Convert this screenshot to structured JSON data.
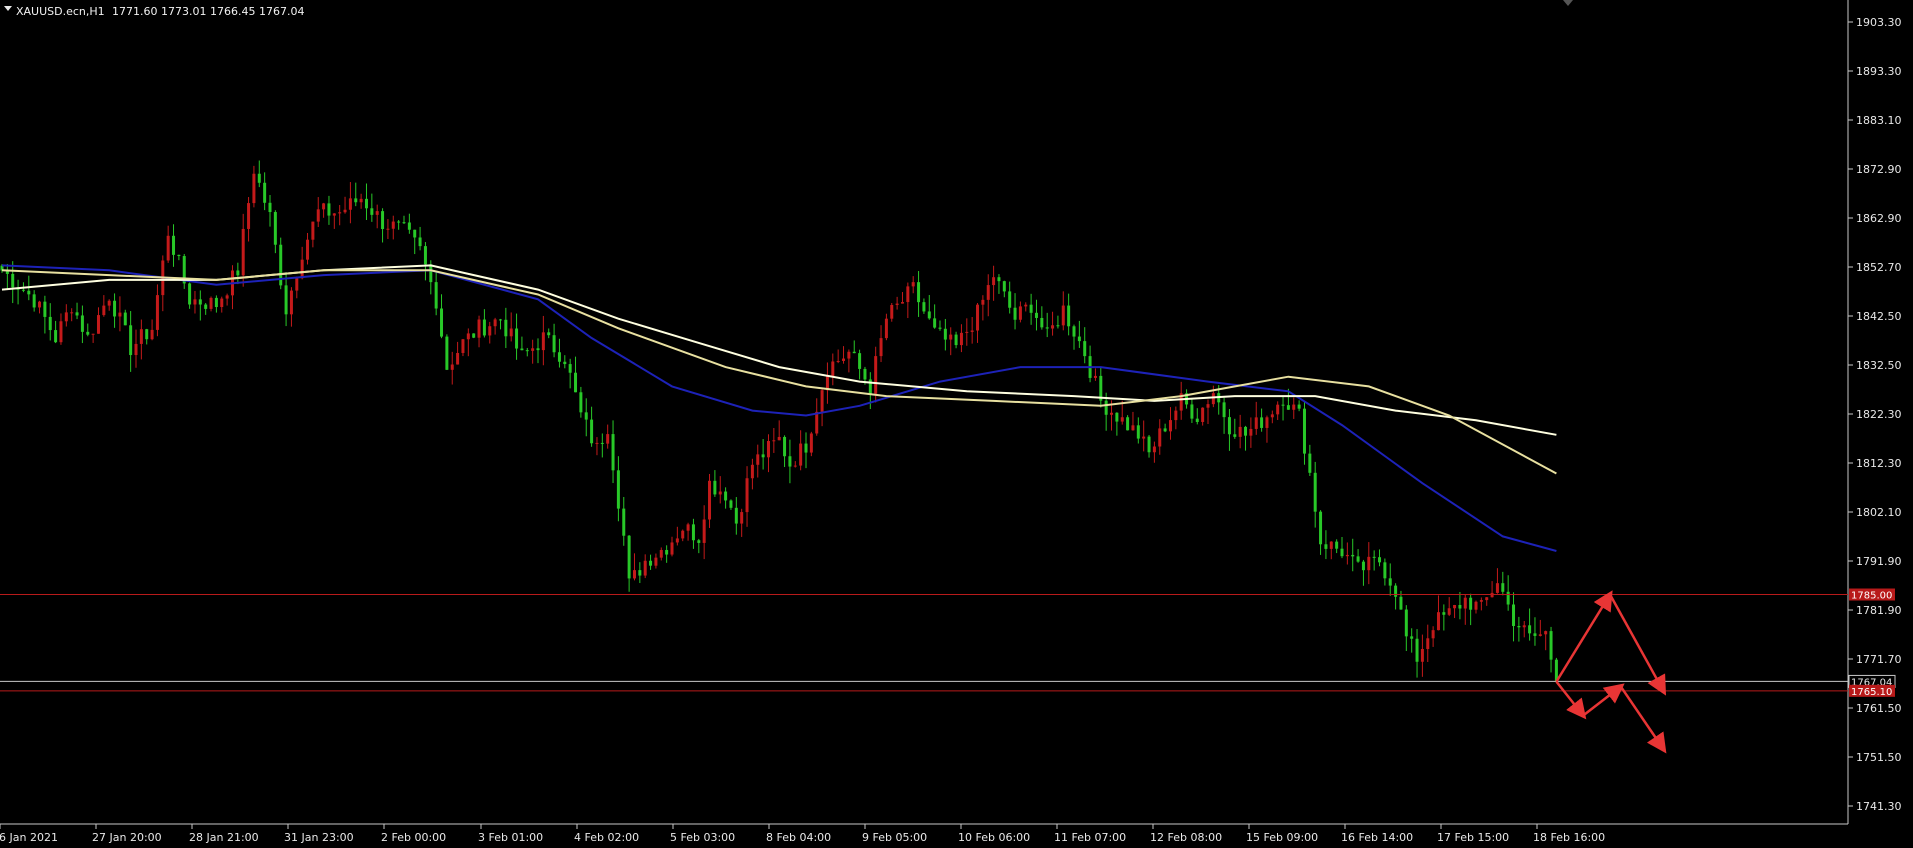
{
  "header": {
    "symbol": "XAUUSD.ecn,H1",
    "ohlc": "1771.60 1773.01 1766.45 1767.04"
  },
  "price_axis": {
    "labels": [
      "1903.30",
      "1893.30",
      "1883.10",
      "1872.90",
      "1862.90",
      "1852.70",
      "1842.50",
      "1832.50",
      "1822.30",
      "1812.30",
      "1802.10",
      "1791.90",
      "1781.90",
      "1771.70",
      "1761.50",
      "1751.50",
      "1741.30"
    ]
  },
  "time_axis": {
    "labels": [
      "26 Jan 2021",
      "27 Jan 20:00",
      "28 Jan 21:00",
      "31 Jan 23:00",
      "2 Feb 00:00",
      "3 Feb 01:00",
      "4 Feb 02:00",
      "5 Feb 03:00",
      "8 Feb 04:00",
      "9 Feb 05:00",
      "10 Feb 06:00",
      "11 Feb 07:00",
      "12 Feb 08:00",
      "15 Feb 09:00",
      "16 Feb 14:00",
      "17 Feb 15:00",
      "18 Feb 16:00"
    ]
  },
  "levels": {
    "resistance": {
      "price": 1785.0,
      "tag": "1785.00",
      "color": "#b81a1a"
    },
    "current": {
      "price": 1767.04,
      "tag": "1767.04",
      "color": "#c8c8c8"
    },
    "support": {
      "price": 1765.1,
      "tag": "1765.10",
      "color": "#b81a1a"
    }
  },
  "colors": {
    "background": "#000000",
    "bull_candle": "#c41a1a",
    "bear_candle": "#28c828",
    "ma_blue": "#1d22b8",
    "ma_light": "#ffffe0",
    "ma_cream": "#e8e0a0",
    "axis": "#c8c8c8",
    "arrow": "#e83535"
  },
  "chart_data": {
    "type": "candlestick",
    "symbol": "XAUUSD.ecn",
    "timeframe": "H1",
    "ylim": [
      1737.0,
      1908.0
    ],
    "close_path": [
      {
        "bar": 0,
        "price": 1852
      },
      {
        "bar": 6,
        "price": 1846
      },
      {
        "bar": 10,
        "price": 1838
      },
      {
        "bar": 13,
        "price": 1845
      },
      {
        "bar": 16,
        "price": 1838
      },
      {
        "bar": 20,
        "price": 1847
      },
      {
        "bar": 24,
        "price": 1836
      },
      {
        "bar": 28,
        "price": 1840
      },
      {
        "bar": 31,
        "price": 1860
      },
      {
        "bar": 35,
        "price": 1846
      },
      {
        "bar": 40,
        "price": 1845
      },
      {
        "bar": 44,
        "price": 1852
      },
      {
        "bar": 47,
        "price": 1873
      },
      {
        "bar": 50,
        "price": 1863
      },
      {
        "bar": 53,
        "price": 1844
      },
      {
        "bar": 56,
        "price": 1856
      },
      {
        "bar": 59,
        "price": 1864
      },
      {
        "bar": 63,
        "price": 1864
      },
      {
        "bar": 67,
        "price": 1867
      },
      {
        "bar": 71,
        "price": 1862
      },
      {
        "bar": 75,
        "price": 1860
      },
      {
        "bar": 78,
        "price": 1856
      },
      {
        "bar": 81,
        "price": 1846
      },
      {
        "bar": 83,
        "price": 1832
      },
      {
        "bar": 86,
        "price": 1837
      },
      {
        "bar": 89,
        "price": 1840
      },
      {
        "bar": 93,
        "price": 1842
      },
      {
        "bar": 97,
        "price": 1834
      },
      {
        "bar": 101,
        "price": 1838
      },
      {
        "bar": 105,
        "price": 1834
      },
      {
        "bar": 108,
        "price": 1822
      },
      {
        "bar": 111,
        "price": 1815
      },
      {
        "bar": 113,
        "price": 1820
      },
      {
        "bar": 116,
        "price": 1797
      },
      {
        "bar": 117,
        "price": 1787
      },
      {
        "bar": 120,
        "price": 1792
      },
      {
        "bar": 124,
        "price": 1795
      },
      {
        "bar": 127,
        "price": 1799
      },
      {
        "bar": 130,
        "price": 1797
      },
      {
        "bar": 132,
        "price": 1808
      },
      {
        "bar": 135,
        "price": 1806
      },
      {
        "bar": 137,
        "price": 1800
      },
      {
        "bar": 140,
        "price": 1812
      },
      {
        "bar": 145,
        "price": 1817
      },
      {
        "bar": 147,
        "price": 1812
      },
      {
        "bar": 150,
        "price": 1816
      },
      {
        "bar": 154,
        "price": 1832
      },
      {
        "bar": 158,
        "price": 1835
      },
      {
        "bar": 162,
        "price": 1828
      },
      {
        "bar": 165,
        "price": 1842
      },
      {
        "bar": 170,
        "price": 1848
      },
      {
        "bar": 174,
        "price": 1839
      },
      {
        "bar": 178,
        "price": 1836
      },
      {
        "bar": 182,
        "price": 1843
      },
      {
        "bar": 185,
        "price": 1851
      },
      {
        "bar": 189,
        "price": 1842
      },
      {
        "bar": 192,
        "price": 1845
      },
      {
        "bar": 195,
        "price": 1838
      },
      {
        "bar": 198,
        "price": 1844
      },
      {
        "bar": 202,
        "price": 1835
      },
      {
        "bar": 205,
        "price": 1825
      },
      {
        "bar": 208,
        "price": 1822
      },
      {
        "bar": 212,
        "price": 1818
      },
      {
        "bar": 214,
        "price": 1814
      },
      {
        "bar": 217,
        "price": 1820
      },
      {
        "bar": 220,
        "price": 1825
      },
      {
        "bar": 223,
        "price": 1822
      },
      {
        "bar": 226,
        "price": 1827
      },
      {
        "bar": 229,
        "price": 1820
      },
      {
        "bar": 232,
        "price": 1818
      },
      {
        "bar": 236,
        "price": 1822
      },
      {
        "bar": 239,
        "price": 1826
      },
      {
        "bar": 242,
        "price": 1822
      },
      {
        "bar": 244,
        "price": 1810
      },
      {
        "bar": 246,
        "price": 1796
      },
      {
        "bar": 250,
        "price": 1794
      },
      {
        "bar": 253,
        "price": 1790
      },
      {
        "bar": 257,
        "price": 1792
      },
      {
        "bar": 260,
        "price": 1786
      },
      {
        "bar": 262,
        "price": 1776
      },
      {
        "bar": 264,
        "price": 1772
      },
      {
        "bar": 267,
        "price": 1779
      },
      {
        "bar": 270,
        "price": 1781
      },
      {
        "bar": 273,
        "price": 1784
      },
      {
        "bar": 276,
        "price": 1782
      },
      {
        "bar": 279,
        "price": 1788
      },
      {
        "bar": 282,
        "price": 1780
      },
      {
        "bar": 285,
        "price": 1776
      },
      {
        "bar": 288,
        "price": 1777
      },
      {
        "bar": 290,
        "price": 1767
      }
    ],
    "ma_blue": [
      [
        0,
        1853
      ],
      [
        20,
        1852
      ],
      [
        40,
        1849
      ],
      [
        60,
        1851
      ],
      [
        80,
        1852
      ],
      [
        100,
        1846
      ],
      [
        110,
        1838
      ],
      [
        125,
        1828
      ],
      [
        140,
        1823
      ],
      [
        150,
        1822
      ],
      [
        160,
        1824
      ],
      [
        175,
        1829
      ],
      [
        190,
        1832
      ],
      [
        205,
        1832
      ],
      [
        225,
        1829
      ],
      [
        240,
        1827
      ],
      [
        250,
        1820
      ],
      [
        265,
        1808
      ],
      [
        280,
        1797
      ],
      [
        290,
        1794
      ]
    ],
    "ma_light": [
      [
        0,
        1848
      ],
      [
        20,
        1850
      ],
      [
        40,
        1850
      ],
      [
        60,
        1852
      ],
      [
        80,
        1853
      ],
      [
        100,
        1848
      ],
      [
        115,
        1842
      ],
      [
        130,
        1837
      ],
      [
        145,
        1832
      ],
      [
        160,
        1829
      ],
      [
        180,
        1827
      ],
      [
        200,
        1826
      ],
      [
        215,
        1825
      ],
      [
        230,
        1826
      ],
      [
        245,
        1826
      ],
      [
        260,
        1823
      ],
      [
        275,
        1821
      ],
      [
        290,
        1818
      ]
    ],
    "ma_cream": [
      [
        0,
        1852
      ],
      [
        20,
        1851
      ],
      [
        40,
        1850
      ],
      [
        60,
        1852
      ],
      [
        80,
        1852
      ],
      [
        100,
        1847
      ],
      [
        115,
        1840
      ],
      [
        135,
        1832
      ],
      [
        150,
        1828
      ],
      [
        165,
        1826
      ],
      [
        185,
        1825
      ],
      [
        205,
        1824
      ],
      [
        220,
        1826
      ],
      [
        240,
        1830
      ],
      [
        255,
        1828
      ],
      [
        270,
        1822
      ],
      [
        290,
        1810
      ]
    ],
    "forecast_arrows": [
      [
        [
          290,
          1767
        ],
        [
          300,
          1785
        ],
        [
          310,
          1765
        ]
      ],
      [
        [
          290,
          1767
        ],
        [
          295,
          1760
        ],
        [
          302,
          1766
        ],
        [
          310,
          1753
        ]
      ]
    ]
  }
}
